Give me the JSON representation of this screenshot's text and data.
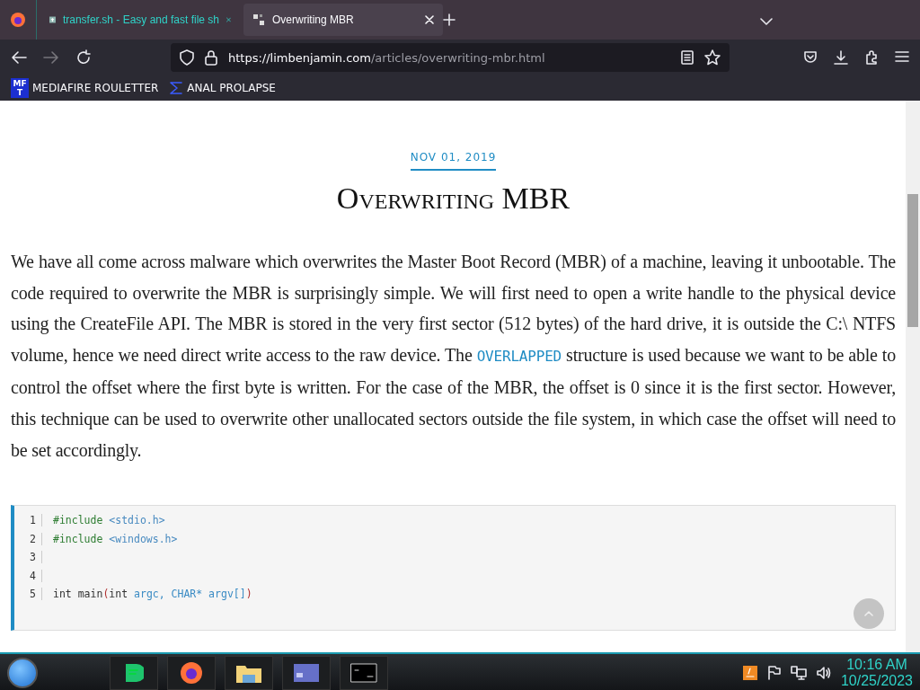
{
  "tabs": [
    {
      "title": "transfer.sh - Easy and fast file sh",
      "selected": false
    },
    {
      "title": "Overwriting MBR",
      "selected": true
    }
  ],
  "address": {
    "host": "https://limbenjamin.com",
    "path": "/articles/overwriting-mbr.html"
  },
  "bookmarks": [
    {
      "label": "MEDIAFIRE ROULETTER",
      "icon_text": "MF T"
    },
    {
      "label": "ANAL PROLAPSE"
    }
  ],
  "article": {
    "date": "NOV 01, 2019",
    "title": "Overwriting MBR",
    "paragraph": [
      {
        "kind": "text",
        "text": "We have all come across malware which overwrites the Master Boot Record (MBR) of a machine, leaving it unbootable. The code required to overwrite the MBR is surprisingly simple. We will first need to open a write handle to the physical device using the CreateFile API. The MBR is stored in the very first sector (512 bytes) of the hard drive, it is outside the C:\\ NTFS volume, hence we need direct write access to the raw device. The "
      },
      {
        "kind": "code",
        "text": "OVERLAPPED"
      },
      {
        "kind": "text",
        "text": " structure is used because we want to be able to control the offset where the first byte is written. For the case of the MBR, the offset is 0 since it is the first sector. However, this technique can be used to overwrite other unallocated sectors outside the file system, in which case the offset will need to be set accordingly."
      }
    ],
    "code": [
      {
        "number": "1",
        "tokens": [
          {
            "kind": "directive",
            "text": "#include "
          },
          {
            "kind": "string",
            "text": "<stdio.h>"
          }
        ]
      },
      {
        "number": "2",
        "tokens": [
          {
            "kind": "directive",
            "text": "#include "
          },
          {
            "kind": "string",
            "text": "<windows.h>"
          }
        ]
      },
      {
        "number": "3"
      },
      {
        "number": "4"
      },
      {
        "number": "5",
        "tokens": [
          {
            "kind": "plain",
            "text": "int main"
          },
          {
            "kind": "punct",
            "text": "("
          },
          {
            "kind": "plain",
            "text": "int "
          },
          {
            "kind": "name",
            "text": "argc, CHAR* argv[]"
          },
          {
            "kind": "punct",
            "text": ")"
          }
        ]
      }
    ]
  },
  "clock": {
    "time": "10:16 AM",
    "date": "10/25/2023"
  }
}
